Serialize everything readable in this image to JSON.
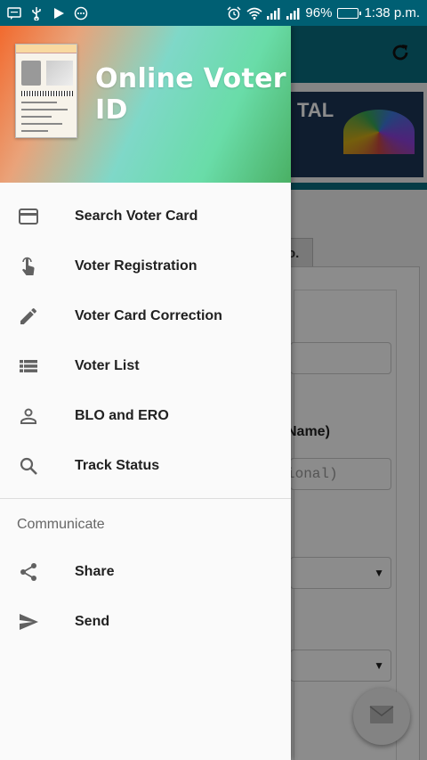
{
  "status_bar": {
    "battery": "96%",
    "time": "1:38 p.m.",
    "battery_level": 0.96,
    "icons": [
      "message-icon",
      "usb-icon",
      "play-icon",
      "more-circle-icon",
      "alarm-icon",
      "wifi-icon",
      "signal-icon",
      "signal-icon-2",
      "battery-icon"
    ]
  },
  "drawer": {
    "header": {
      "title": "Online Voter ID",
      "gradient": [
        "#f26a2e",
        "#7fd8c8",
        "#4ab064"
      ]
    },
    "items": [
      {
        "label": "Search Voter Card",
        "icon": "card-icon"
      },
      {
        "label": "Voter Registration",
        "icon": "touch-icon"
      },
      {
        "label": "Voter Card Correction",
        "icon": "pencil-icon"
      },
      {
        "label": "Voter List",
        "icon": "list-icon"
      },
      {
        "label": "BLO and ERO",
        "icon": "person-icon"
      },
      {
        "label": "Track Status",
        "icon": "search-icon"
      }
    ],
    "section_title": "Communicate",
    "section_items": [
      {
        "label": "Share",
        "icon": "share-icon"
      },
      {
        "label": "Send",
        "icon": "send-icon"
      }
    ]
  },
  "background": {
    "tab_fragment": "o.",
    "label_fragment": "Name)",
    "placeholder_fragment": "ional)",
    "banner_text": "TAL",
    "toolbar_color": "#0a6e80"
  }
}
